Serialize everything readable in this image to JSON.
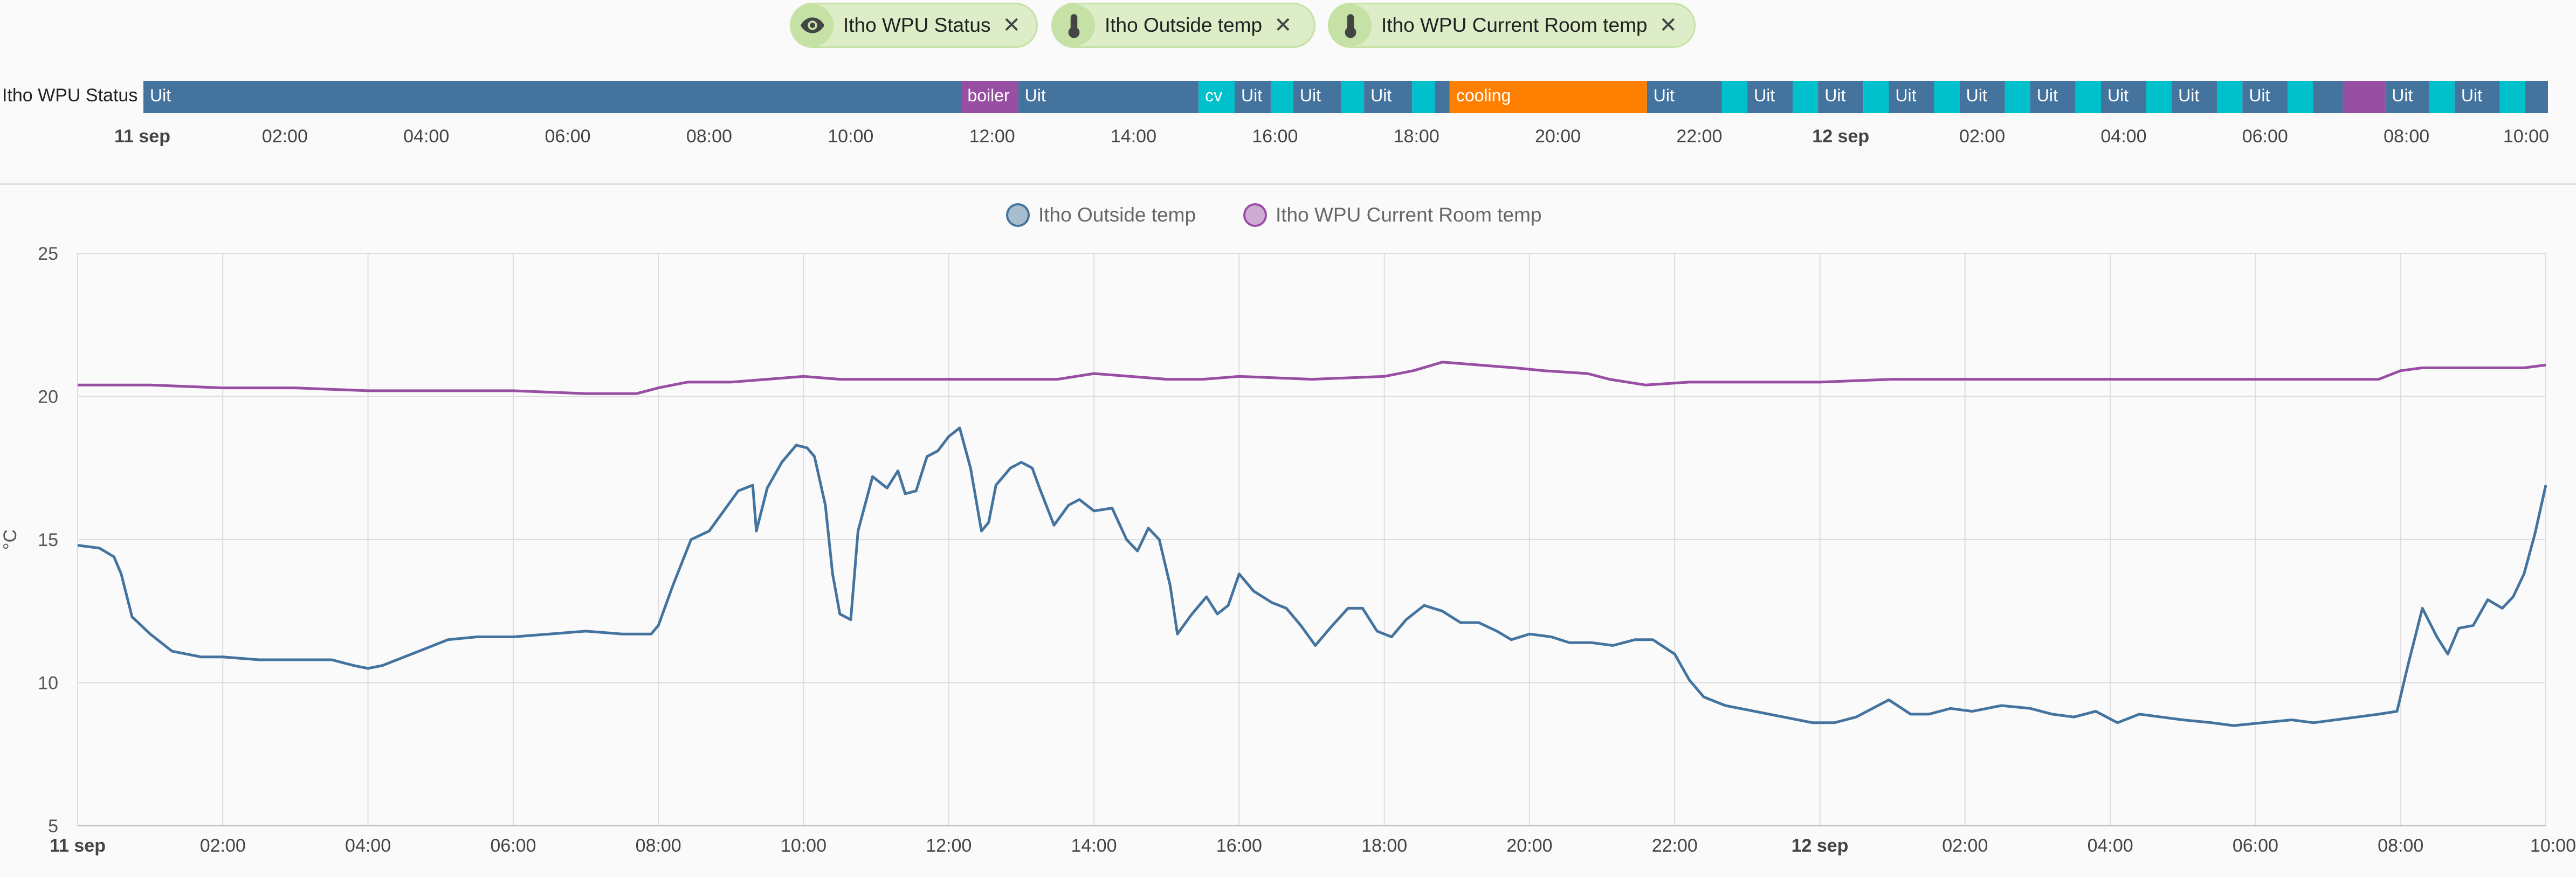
{
  "chips": [
    {
      "label": "Itho WPU Status",
      "icon": "eye-icon"
    },
    {
      "label": "Itho Outside temp",
      "icon": "thermometer-icon"
    },
    {
      "label": "Itho WPU Current Room temp",
      "icon": "thermometer-icon"
    }
  ],
  "close_glyph": "✕",
  "colors": {
    "uit": "#44739e",
    "boiler": "#984ea3",
    "cv": "#00c0cb",
    "cooling": "#ff7f00",
    "outside": "#44739e",
    "room": "#984ea3"
  },
  "timeline": {
    "entity_label": "Itho WPU Status",
    "start_hour": 0,
    "end_hour": 34,
    "segments": [
      {
        "s": 0.0,
        "e": 11.56,
        "state": "Uit",
        "text": "Uit"
      },
      {
        "s": 11.56,
        "e": 12.37,
        "state": "boiler",
        "text": "boiler"
      },
      {
        "s": 12.37,
        "e": 14.92,
        "state": "Uit",
        "text": "Uit"
      },
      {
        "s": 14.92,
        "e": 15.43,
        "state": "cv",
        "text": "cv"
      },
      {
        "s": 15.43,
        "e": 15.94,
        "state": "Uit",
        "text": "Uit"
      },
      {
        "s": 15.94,
        "e": 16.26,
        "state": "cv",
        "text": ""
      },
      {
        "s": 16.26,
        "e": 16.94,
        "state": "Uit",
        "text": "Uit"
      },
      {
        "s": 16.94,
        "e": 17.26,
        "state": "cv",
        "text": ""
      },
      {
        "s": 17.26,
        "e": 17.94,
        "state": "Uit",
        "text": "Uit"
      },
      {
        "s": 17.94,
        "e": 18.26,
        "state": "cv",
        "text": ""
      },
      {
        "s": 18.26,
        "e": 18.47,
        "state": "Uit",
        "text": ""
      },
      {
        "s": 18.47,
        "e": 21.26,
        "state": "cooling",
        "text": "cooling"
      },
      {
        "s": 21.26,
        "e": 22.32,
        "state": "Uit",
        "text": "Uit"
      },
      {
        "s": 22.32,
        "e": 22.68,
        "state": "cv",
        "text": ""
      },
      {
        "s": 22.68,
        "e": 23.32,
        "state": "Uit",
        "text": "Uit"
      },
      {
        "s": 23.32,
        "e": 23.68,
        "state": "cv",
        "text": ""
      },
      {
        "s": 23.68,
        "e": 24.32,
        "state": "Uit",
        "text": "Uit"
      },
      {
        "s": 24.32,
        "e": 24.68,
        "state": "cv",
        "text": ""
      },
      {
        "s": 24.68,
        "e": 25.32,
        "state": "Uit",
        "text": "Uit"
      },
      {
        "s": 25.32,
        "e": 25.68,
        "state": "cv",
        "text": ""
      },
      {
        "s": 25.68,
        "e": 26.32,
        "state": "Uit",
        "text": "Uit"
      },
      {
        "s": 26.32,
        "e": 26.68,
        "state": "cv",
        "text": ""
      },
      {
        "s": 26.68,
        "e": 27.32,
        "state": "Uit",
        "text": "Uit"
      },
      {
        "s": 27.32,
        "e": 27.68,
        "state": "cv",
        "text": ""
      },
      {
        "s": 27.68,
        "e": 28.32,
        "state": "Uit",
        "text": "Uit"
      },
      {
        "s": 28.32,
        "e": 28.68,
        "state": "cv",
        "text": ""
      },
      {
        "s": 28.68,
        "e": 29.32,
        "state": "Uit",
        "text": "Uit"
      },
      {
        "s": 29.32,
        "e": 29.68,
        "state": "cv",
        "text": ""
      },
      {
        "s": 29.68,
        "e": 30.32,
        "state": "Uit",
        "text": "Uit"
      },
      {
        "s": 30.32,
        "e": 30.68,
        "state": "cv",
        "text": ""
      },
      {
        "s": 30.68,
        "e": 31.1,
        "state": "Uit",
        "text": ""
      },
      {
        "s": 31.1,
        "e": 31.7,
        "state": "boiler",
        "text": ""
      },
      {
        "s": 31.7,
        "e": 32.32,
        "state": "Uit",
        "text": "Uit"
      },
      {
        "s": 32.32,
        "e": 32.68,
        "state": "cv",
        "text": ""
      },
      {
        "s": 32.68,
        "e": 33.32,
        "state": "Uit",
        "text": "Uit"
      },
      {
        "s": 33.32,
        "e": 33.68,
        "state": "cv",
        "text": ""
      },
      {
        "s": 33.68,
        "e": 34.0,
        "state": "Uit",
        "text": ""
      }
    ],
    "ticks": [
      {
        "h": 0,
        "label": "11 sep",
        "bold": true
      },
      {
        "h": 2,
        "label": "02:00"
      },
      {
        "h": 4,
        "label": "04:00"
      },
      {
        "h": 6,
        "label": "06:00"
      },
      {
        "h": 8,
        "label": "08:00"
      },
      {
        "h": 10,
        "label": "10:00"
      },
      {
        "h": 12,
        "label": "12:00"
      },
      {
        "h": 14,
        "label": "14:00"
      },
      {
        "h": 16,
        "label": "16:00"
      },
      {
        "h": 18,
        "label": "18:00"
      },
      {
        "h": 20,
        "label": "20:00"
      },
      {
        "h": 22,
        "label": "22:00"
      },
      {
        "h": 24,
        "label": "12 sep",
        "bold": true
      },
      {
        "h": 26,
        "label": "02:00"
      },
      {
        "h": 28,
        "label": "04:00"
      },
      {
        "h": 30,
        "label": "06:00"
      },
      {
        "h": 32,
        "label": "08:00"
      },
      {
        "h": 34,
        "label": "10:00"
      }
    ]
  },
  "chart_data": {
    "type": "line",
    "title": "",
    "xlabel": "",
    "ylabel": "°C",
    "ylim": [
      5,
      25
    ],
    "yticks": [
      5,
      10,
      15,
      20,
      25
    ],
    "xlim": [
      "11 sep 00:00",
      "12 sep 10:00"
    ],
    "grid": true,
    "legend": "top-center",
    "xticks": [
      {
        "h": 0,
        "label": "11 sep",
        "bold": true
      },
      {
        "h": 2,
        "label": "02:00"
      },
      {
        "h": 4,
        "label": "04:00"
      },
      {
        "h": 6,
        "label": "06:00"
      },
      {
        "h": 8,
        "label": "08:00"
      },
      {
        "h": 10,
        "label": "10:00"
      },
      {
        "h": 12,
        "label": "12:00"
      },
      {
        "h": 14,
        "label": "14:00"
      },
      {
        "h": 16,
        "label": "16:00"
      },
      {
        "h": 18,
        "label": "18:00"
      },
      {
        "h": 20,
        "label": "20:00"
      },
      {
        "h": 22,
        "label": "22:00"
      },
      {
        "h": 24,
        "label": "12 sep",
        "bold": true
      },
      {
        "h": 26,
        "label": "02:00"
      },
      {
        "h": 28,
        "label": "04:00"
      },
      {
        "h": 30,
        "label": "06:00"
      },
      {
        "h": 32,
        "label": "08:00"
      },
      {
        "h": 34,
        "label": "10:00"
      }
    ],
    "series": [
      {
        "name": "Itho Outside temp",
        "color": "#44739e",
        "points": [
          [
            0,
            14.8
          ],
          [
            0.3,
            14.7
          ],
          [
            0.5,
            14.4
          ],
          [
            0.6,
            13.8
          ],
          [
            0.75,
            12.3
          ],
          [
            1.0,
            11.7
          ],
          [
            1.3,
            11.1
          ],
          [
            1.7,
            10.9
          ],
          [
            2.0,
            10.9
          ],
          [
            2.5,
            10.8
          ],
          [
            3.0,
            10.8
          ],
          [
            3.5,
            10.8
          ],
          [
            3.8,
            10.6
          ],
          [
            4.0,
            10.5
          ],
          [
            4.2,
            10.6
          ],
          [
            4.5,
            10.9
          ],
          [
            4.8,
            11.2
          ],
          [
            5.1,
            11.5
          ],
          [
            5.5,
            11.6
          ],
          [
            6.0,
            11.6
          ],
          [
            6.5,
            11.7
          ],
          [
            7.0,
            11.8
          ],
          [
            7.5,
            11.7
          ],
          [
            7.9,
            11.7
          ],
          [
            8.0,
            12.0
          ],
          [
            8.2,
            13.4
          ],
          [
            8.45,
            15.0
          ],
          [
            8.7,
            15.3
          ],
          [
            8.9,
            16.0
          ],
          [
            9.1,
            16.7
          ],
          [
            9.3,
            16.9
          ],
          [
            9.35,
            15.3
          ],
          [
            9.5,
            16.8
          ],
          [
            9.7,
            17.7
          ],
          [
            9.9,
            18.3
          ],
          [
            10.05,
            18.2
          ],
          [
            10.15,
            17.9
          ],
          [
            10.3,
            16.2
          ],
          [
            10.4,
            13.8
          ],
          [
            10.5,
            12.4
          ],
          [
            10.65,
            12.2
          ],
          [
            10.75,
            15.3
          ],
          [
            10.95,
            17.2
          ],
          [
            11.15,
            16.8
          ],
          [
            11.3,
            17.4
          ],
          [
            11.4,
            16.6
          ],
          [
            11.55,
            16.7
          ],
          [
            11.7,
            17.9
          ],
          [
            11.85,
            18.1
          ],
          [
            12.0,
            18.6
          ],
          [
            12.15,
            18.9
          ],
          [
            12.3,
            17.5
          ],
          [
            12.45,
            15.3
          ],
          [
            12.55,
            15.6
          ],
          [
            12.65,
            16.9
          ],
          [
            12.85,
            17.5
          ],
          [
            13.0,
            17.7
          ],
          [
            13.15,
            17.5
          ],
          [
            13.25,
            16.8
          ],
          [
            13.45,
            15.5
          ],
          [
            13.65,
            16.2
          ],
          [
            13.8,
            16.4
          ],
          [
            14.0,
            16.0
          ],
          [
            14.25,
            16.1
          ],
          [
            14.45,
            15.0
          ],
          [
            14.6,
            14.6
          ],
          [
            14.75,
            15.4
          ],
          [
            14.9,
            15.0
          ],
          [
            15.05,
            13.4
          ],
          [
            15.15,
            11.7
          ],
          [
            15.35,
            12.4
          ],
          [
            15.55,
            13.0
          ],
          [
            15.7,
            12.4
          ],
          [
            15.85,
            12.7
          ],
          [
            16.0,
            13.8
          ],
          [
            16.2,
            13.2
          ],
          [
            16.45,
            12.8
          ],
          [
            16.65,
            12.6
          ],
          [
            16.85,
            12.0
          ],
          [
            17.05,
            11.3
          ],
          [
            17.25,
            11.9
          ],
          [
            17.5,
            12.6
          ],
          [
            17.7,
            12.6
          ],
          [
            17.9,
            11.8
          ],
          [
            18.1,
            11.6
          ],
          [
            18.3,
            12.2
          ],
          [
            18.55,
            12.7
          ],
          [
            18.8,
            12.5
          ],
          [
            19.05,
            12.1
          ],
          [
            19.3,
            12.1
          ],
          [
            19.55,
            11.8
          ],
          [
            19.75,
            11.5
          ],
          [
            20.0,
            11.7
          ],
          [
            20.3,
            11.6
          ],
          [
            20.55,
            11.4
          ],
          [
            20.85,
            11.4
          ],
          [
            21.15,
            11.3
          ],
          [
            21.45,
            11.5
          ],
          [
            21.7,
            11.5
          ],
          [
            22.0,
            11.0
          ],
          [
            22.2,
            10.1
          ],
          [
            22.4,
            9.5
          ],
          [
            22.7,
            9.2
          ],
          [
            23.1,
            9.0
          ],
          [
            23.5,
            8.8
          ],
          [
            23.9,
            8.6
          ],
          [
            24.2,
            8.6
          ],
          [
            24.5,
            8.8
          ],
          [
            24.8,
            9.2
          ],
          [
            24.95,
            9.4
          ],
          [
            25.25,
            8.9
          ],
          [
            25.5,
            8.9
          ],
          [
            25.8,
            9.1
          ],
          [
            26.1,
            9.0
          ],
          [
            26.5,
            9.2
          ],
          [
            26.9,
            9.1
          ],
          [
            27.2,
            8.9
          ],
          [
            27.5,
            8.8
          ],
          [
            27.8,
            9.0
          ],
          [
            28.1,
            8.6
          ],
          [
            28.4,
            8.9
          ],
          [
            28.7,
            8.8
          ],
          [
            29.0,
            8.7
          ],
          [
            29.4,
            8.6
          ],
          [
            29.7,
            8.5
          ],
          [
            30.1,
            8.6
          ],
          [
            30.5,
            8.7
          ],
          [
            30.8,
            8.6
          ],
          [
            31.1,
            8.7
          ],
          [
            31.4,
            8.8
          ],
          [
            31.7,
            8.9
          ],
          [
            31.95,
            9.0
          ],
          [
            32.1,
            10.6
          ],
          [
            32.3,
            12.6
          ],
          [
            32.5,
            11.6
          ],
          [
            32.65,
            11.0
          ],
          [
            32.8,
            11.9
          ],
          [
            33.0,
            12.0
          ],
          [
            33.2,
            12.9
          ],
          [
            33.4,
            12.6
          ],
          [
            33.55,
            13.0
          ],
          [
            33.7,
            13.8
          ],
          [
            33.85,
            15.2
          ],
          [
            34.0,
            16.9
          ]
        ]
      },
      {
        "name": "Itho WPU Current Room temp",
        "color": "#984ea3",
        "points": [
          [
            0,
            20.4
          ],
          [
            1,
            20.4
          ],
          [
            2,
            20.3
          ],
          [
            3,
            20.3
          ],
          [
            4,
            20.2
          ],
          [
            5,
            20.2
          ],
          [
            6,
            20.2
          ],
          [
            7,
            20.1
          ],
          [
            7.7,
            20.1
          ],
          [
            8.0,
            20.3
          ],
          [
            8.4,
            20.5
          ],
          [
            9.0,
            20.5
          ],
          [
            9.5,
            20.6
          ],
          [
            10.0,
            20.7
          ],
          [
            10.5,
            20.6
          ],
          [
            11.5,
            20.6
          ],
          [
            12.5,
            20.6
          ],
          [
            13.5,
            20.6
          ],
          [
            14.0,
            20.8
          ],
          [
            14.5,
            20.7
          ],
          [
            15.0,
            20.6
          ],
          [
            15.5,
            20.6
          ],
          [
            16.0,
            20.7
          ],
          [
            17.0,
            20.6
          ],
          [
            18.0,
            20.7
          ],
          [
            18.4,
            20.9
          ],
          [
            18.8,
            21.2
          ],
          [
            19.3,
            21.1
          ],
          [
            19.8,
            21.0
          ],
          [
            20.2,
            20.9
          ],
          [
            20.8,
            20.8
          ],
          [
            21.1,
            20.6
          ],
          [
            21.6,
            20.4
          ],
          [
            22.2,
            20.5
          ],
          [
            23,
            20.5
          ],
          [
            24,
            20.5
          ],
          [
            25,
            20.6
          ],
          [
            26,
            20.6
          ],
          [
            27,
            20.6
          ],
          [
            28,
            20.6
          ],
          [
            29,
            20.6
          ],
          [
            30,
            20.6
          ],
          [
            31,
            20.6
          ],
          [
            31.7,
            20.6
          ],
          [
            32.0,
            20.9
          ],
          [
            32.3,
            21.0
          ],
          [
            33,
            21.0
          ],
          [
            33.7,
            21.0
          ],
          [
            34.0,
            21.1
          ]
        ]
      }
    ]
  }
}
